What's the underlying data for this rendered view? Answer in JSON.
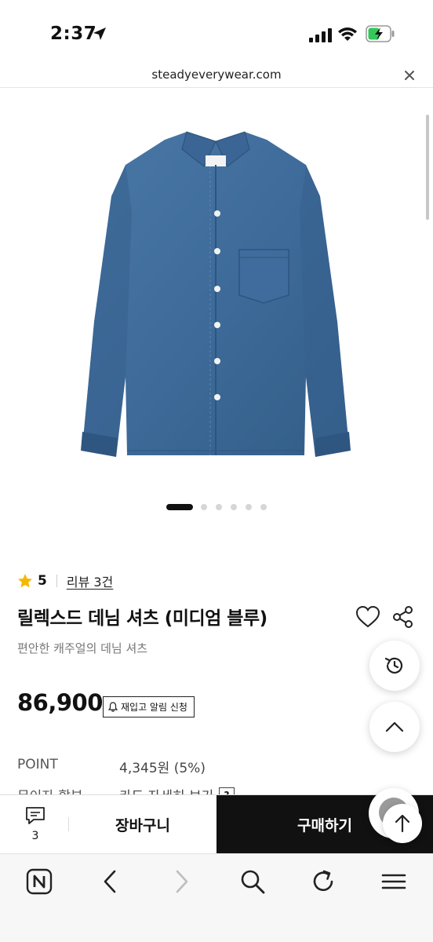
{
  "status_bar": {
    "time": "2:37"
  },
  "browser": {
    "url": "steadyeverywear.com"
  },
  "product": {
    "image_icon": "denim-shirt",
    "carousel": {
      "total": 6,
      "active_index": 0
    },
    "rating": "5",
    "review_link": "리뷰 3건",
    "title": "릴렉스드 데님 셔츠 (미디엄 블루)",
    "subtitle": "편안한 캐주얼의 데님 셔츠",
    "price": "86,900",
    "restock_button": "재입고 알림 신청",
    "point_label": "POINT",
    "point_value": "4,345원 (5%)",
    "installment_label": "무이자 할부",
    "installment_value": "카드 자세히 보기",
    "help_mark": "?"
  },
  "action_bar": {
    "chat_count": "3",
    "cart_label": "장바구니",
    "buy_label": "구매하기"
  },
  "colors": {
    "accent_star": "#f5b800",
    "buy_button_bg": "#111111",
    "denim": "#3f6c9c"
  },
  "icons": {
    "toolbar": [
      "naver-home-icon",
      "back-icon",
      "forward-icon",
      "search-icon",
      "reload-icon",
      "menu-icon"
    ]
  }
}
